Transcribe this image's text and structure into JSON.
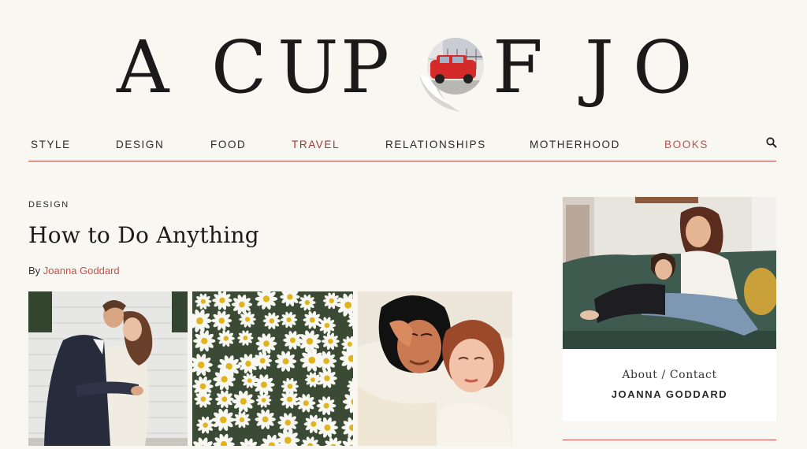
{
  "logo": {
    "letters": [
      "A",
      "C",
      "U",
      "P",
      "F",
      "J",
      "O"
    ],
    "alt": "A CUP OF JO"
  },
  "nav": {
    "items": [
      {
        "label": "STYLE",
        "color": "#2a2a2a"
      },
      {
        "label": "DESIGN",
        "color": "#2a2a2a"
      },
      {
        "label": "FOOD",
        "color": "#2a2a2a"
      },
      {
        "label": "TRAVEL",
        "color": "#9a3a36"
      },
      {
        "label": "RELATIONSHIPS",
        "color": "#2a2a2a"
      },
      {
        "label": "MOTHERHOOD",
        "color": "#2a2a2a"
      },
      {
        "label": "BOOKS",
        "color": "#c0504a"
      }
    ],
    "search_icon": "search-icon"
  },
  "article": {
    "category": "DESIGN",
    "title": "How to Do Anything",
    "byline_prefix": "By ",
    "author": "Joanna Goddard"
  },
  "sidebar": {
    "about_link": "About / Contact",
    "name": "JOANNA GODDARD"
  },
  "colors": {
    "background": "#f9f7f2",
    "accent": "#c8504a",
    "text": "#1f1f1f"
  }
}
